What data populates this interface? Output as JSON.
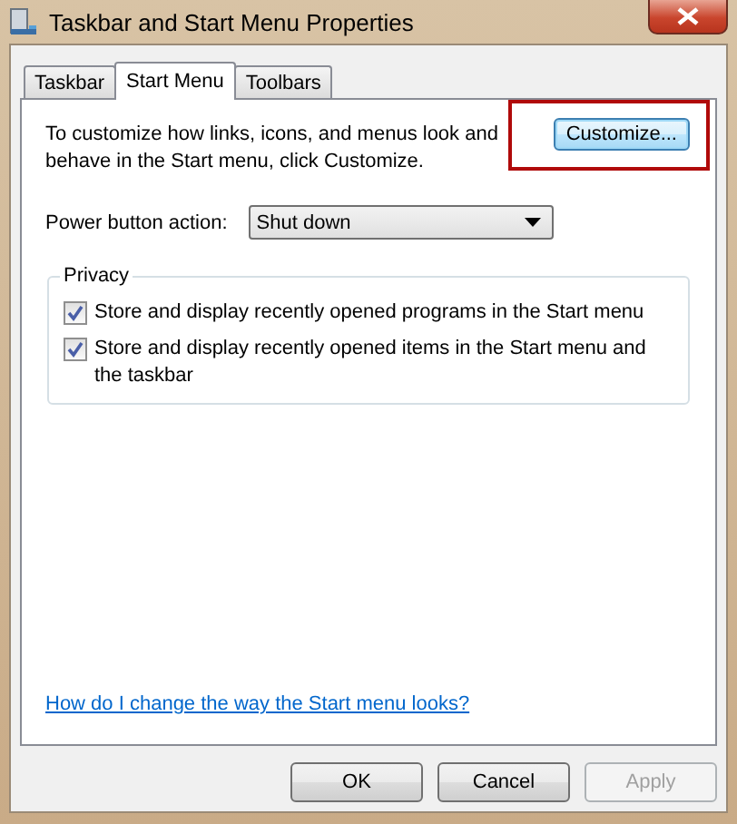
{
  "window": {
    "title": "Taskbar and Start Menu Properties"
  },
  "tabs": [
    {
      "label": "Taskbar",
      "selected": false
    },
    {
      "label": "Start Menu",
      "selected": true
    },
    {
      "label": "Toolbars",
      "selected": false
    }
  ],
  "description": "To customize how links, icons, and menus look and behave in the Start menu, click Customize.",
  "customize_button": {
    "label": "Customize...",
    "highlighted": true
  },
  "power_button_action": {
    "label": "Power button action:",
    "value": "Shut down"
  },
  "privacy": {
    "title": "Privacy",
    "options": [
      {
        "label": "Store and display recently opened programs in the Start menu",
        "checked": true
      },
      {
        "label": "Store and display recently opened items in the Start menu and the taskbar",
        "checked": true
      }
    ]
  },
  "help_link": "How do I change the way the Start menu looks?",
  "buttons": [
    {
      "label": "OK",
      "disabled": false
    },
    {
      "label": "Cancel",
      "disabled": false
    },
    {
      "label": "Apply",
      "disabled": true
    }
  ]
}
